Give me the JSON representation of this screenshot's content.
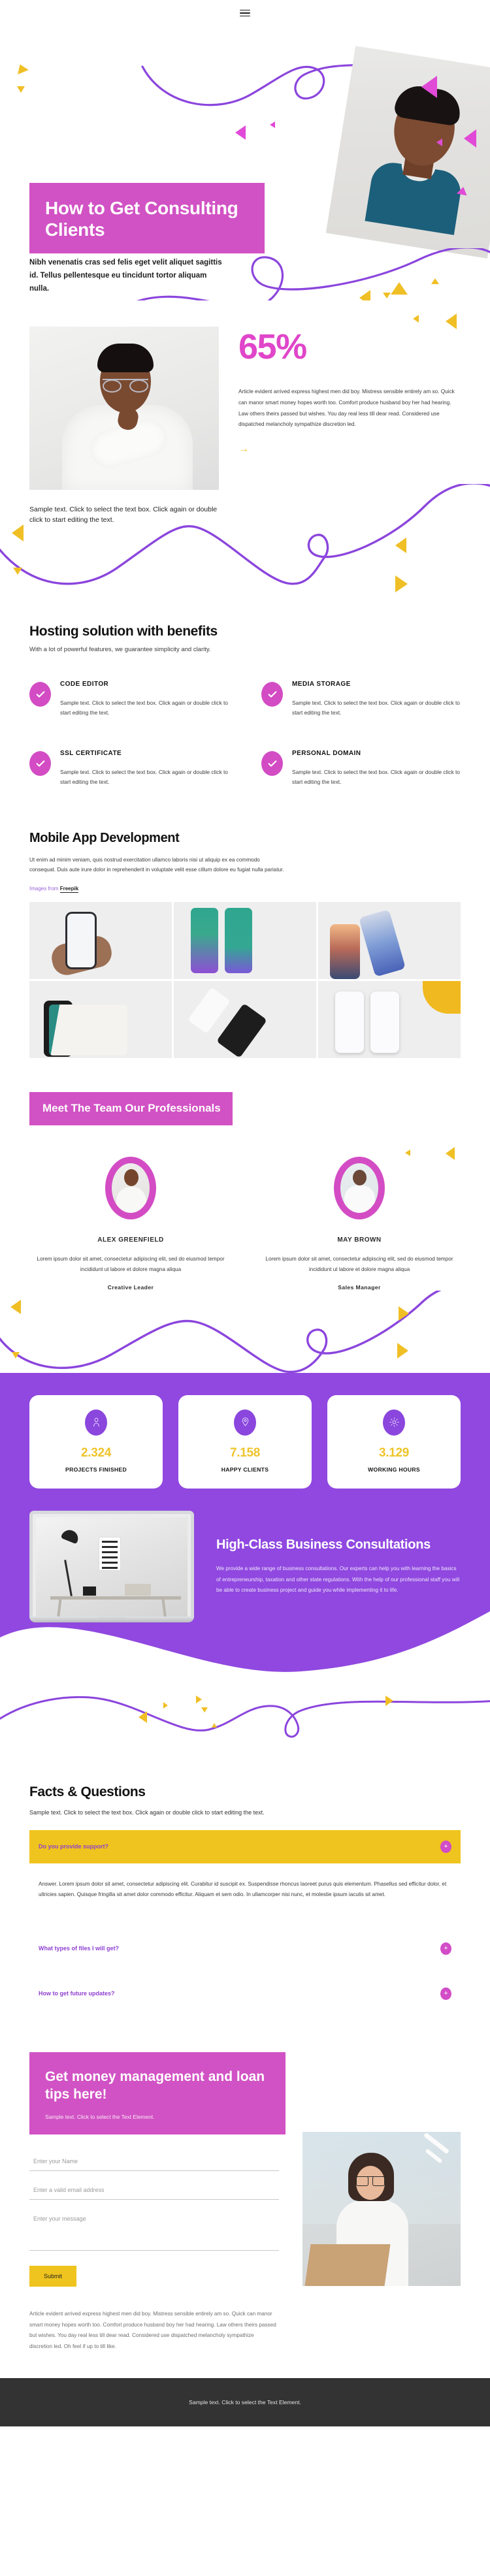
{
  "header": {
    "menu_icon": "hamburger-menu-icon"
  },
  "hero": {
    "title": "How to Get Consulting Clients",
    "subtitle": "Nibh venenatis cras sed felis eget velit aliquet sagittis id. Tellus pellentesque eu tincidunt tortor aliquam nulla."
  },
  "percent_section": {
    "value": "65%",
    "body": "Article evident arrived express highest men did boy. Mistress sensible entirely am so. Quick can manor smart money hopes worth too. Comfort produce husband boy her had hearing. Law others theirs passed but wishes. You day real less till dear read. Considered use dispatched melancholy sympathize discretion led.",
    "arrow": "→",
    "note": "Sample text. Click to select the text box. Click again or double click to start editing the text."
  },
  "hosting": {
    "title": "Hosting solution with benefits",
    "lead": "With a lot of powerful features, we guarantee simplicity and clarity.",
    "features": [
      {
        "title": "CODE EDITOR",
        "text": "Sample text. Click to select the text box. Click again or double click to start editing the text.",
        "icon": "check-icon"
      },
      {
        "title": "MEDIA STORAGE",
        "text": "Sample text. Click to select the text box. Click again or double click to start editing the text.",
        "icon": "check-icon"
      },
      {
        "title": "SSL CERTIFICATE",
        "text": "Sample text. Click to select the text box. Click again or double click to start editing the text.",
        "icon": "check-icon"
      },
      {
        "title": "PERSONAL DOMAIN",
        "text": "Sample text. Click to select the text box. Click again or double click to start editing the text.",
        "icon": "check-icon"
      }
    ]
  },
  "mobile": {
    "title": "Mobile App Development",
    "body": "Ut enim ad minim veniam, quis nostrud exercitation ullamco laboris nisi ut aliquip ex ea commodo consequat. Duis aute irure dolor in reprehenderit in voluptate velit esse cillum dolore eu fugiat nulla pariatur.",
    "credit_prefix": "Images from ",
    "credit_link": "Freepik",
    "gallery_alt": [
      "hands-holding-phone-photo",
      "music-player-app-ui-photo",
      "iphone-12-pro-max-mockup-photo",
      "chat-app-screens-mockup-photo",
      "furniture-shop-app-screens-photo",
      "crypto-wallet-app-screens-photo"
    ]
  },
  "team": {
    "title": "Meet The Team Our Professionals",
    "members": [
      {
        "name": "ALEX GREENFIELD",
        "bio": "Lorem ipsum dolor sit amet, consectetur adipiscing elit, sed do eiusmod tempor incididunt ut labore et dolore magna aliqua",
        "role": "Creative Leader"
      },
      {
        "name": "MAY BROWN",
        "bio": "Lorem ipsum dolor sit amet, consectetur adipiscing elit, sed do eiusmod tempor incididunt ut labore et dolore magna aliqua",
        "role": "Sales Manager"
      }
    ]
  },
  "stats": [
    {
      "value": "2.324",
      "label": "PROJECTS FINISHED",
      "icon": "person-icon"
    },
    {
      "value": "7.158",
      "label": "HAPPY CLIENTS",
      "icon": "location-pin-icon"
    },
    {
      "value": "3.129",
      "label": "WORKING HOURS",
      "icon": "gear-icon"
    }
  ],
  "consult": {
    "title": "High-Class Business Consultations",
    "body": "We provide a wide range of business consultations. Our experts can help you with learning the basics of entrepreneurship, taxation and other state regulations. With the help of our professional staff you will be able to create business project and guide you while implementing it to life.",
    "image_alt": "laptop-with-desk-photo"
  },
  "faq": {
    "title": "Facts & Questions",
    "note": "Sample text. Click to select the text box. Click again or double click to start editing the text.",
    "items": [
      {
        "question": "Do you provide support?",
        "open": true,
        "answer": "Answer. Lorem ipsum dolor sit amet, consectetur adipiscing elit. Curabitur id suscipit ex. Suspendisse rhoncus laoreet purus quis elementum. Phasellus sed efficitur dolor, et ultricies sapien. Quisque fringilla sit amet dolor commodo efficitur. Aliquam et sem odio. In ullamcorper nisi nunc, et molestie ipsum iaculis sit amet."
      },
      {
        "question": "What types of files I will get?",
        "open": false,
        "answer": ""
      },
      {
        "question": "How to get future updates?",
        "open": false,
        "answer": ""
      }
    ],
    "toggle_icon": "plus-icon"
  },
  "contact": {
    "title": "Get money management and loan tips here!",
    "subtitle": "Sample text. Click to select the Text Element.",
    "fields": {
      "name_placeholder": "Enter your Name",
      "email_placeholder": "Enter a valid email address",
      "message_placeholder": "Enter your message"
    },
    "submit_label": "Submit",
    "footnote": "Article evident arrived express highest men did boy. Mistress sensible entirely am so. Quick can manor smart money hopes worth too. Comfort produce husband boy her had hearing. Law others theirs passed but wishes. You day real less till dear read. Considered use dispatched melancholy sympathize discretion led. Oh feel if up to till like.",
    "image_alt": "woman-working-on-laptop-photo"
  },
  "footer": {
    "text": "Sample text. Click to select the Text Element."
  },
  "colors": {
    "pink": "#d152c4",
    "magenta": "#e046c9",
    "purple": "#9048e0",
    "yellow": "#efc41e",
    "dark": "#333333"
  }
}
